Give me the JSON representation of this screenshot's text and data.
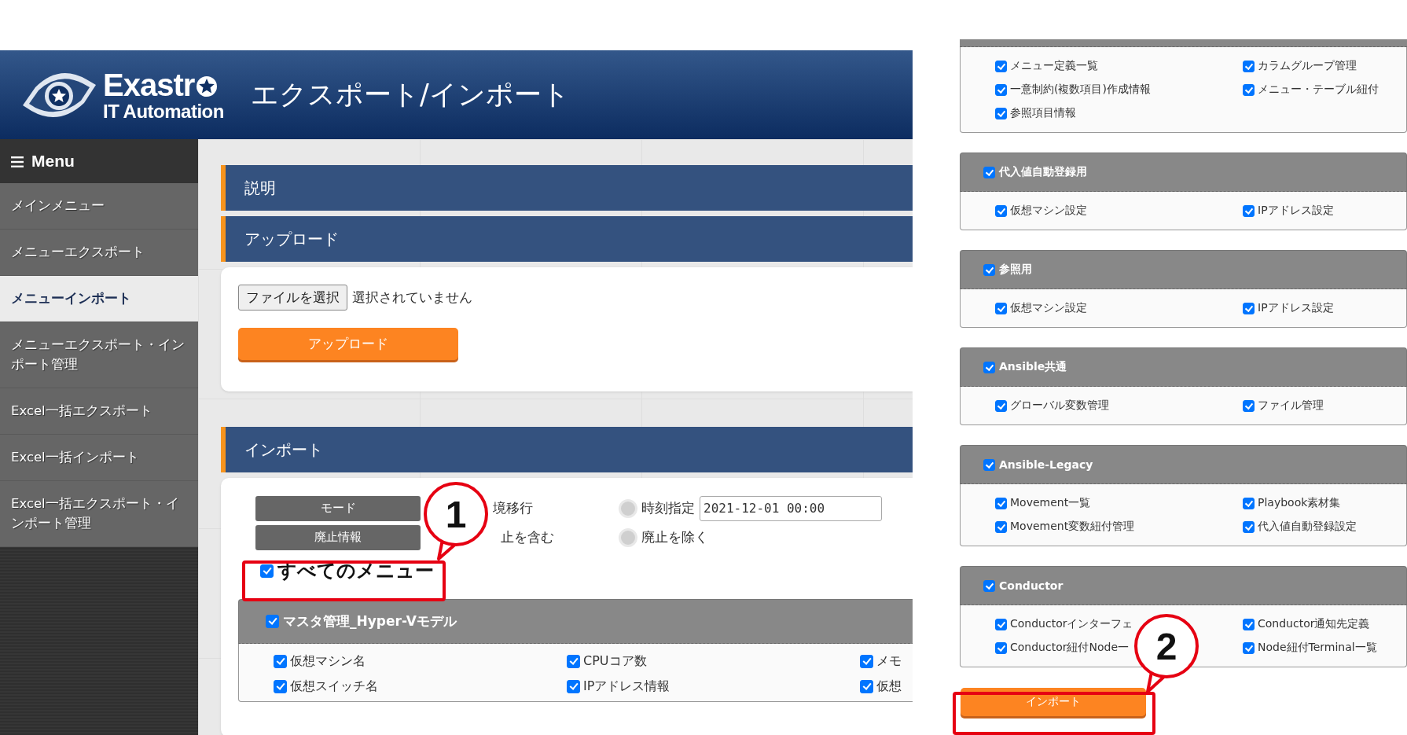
{
  "header": {
    "logo_text": "Exastr",
    "logo_subtext": "IT Automation",
    "title": "エクスポート/インポート"
  },
  "sidebar": {
    "title": "Menu",
    "items": [
      {
        "label": "メインメニュー",
        "selected": false
      },
      {
        "label": "メニューエクスポート",
        "selected": false
      },
      {
        "label": "メニューインポート",
        "selected": true
      },
      {
        "label": "メニューエクスポート・インポート管理",
        "selected": false
      },
      {
        "label": "Excel一括エクスポート",
        "selected": false
      },
      {
        "label": "Excel一括インポート",
        "selected": false
      },
      {
        "label": "Excel一括エクスポート・インポート管理",
        "selected": false
      }
    ]
  },
  "sections": [
    {
      "title": "説明"
    },
    {
      "title": "アップロード"
    }
  ],
  "upload": {
    "file_button": "ファイルを選択",
    "file_status": "選択されていません",
    "button": "アップロード"
  },
  "import": {
    "title": "インポート",
    "rows": [
      {
        "label": "モード",
        "options": [
          {
            "label": "境移行"
          },
          {
            "label": "時刻指定",
            "selected": false,
            "value": "2021-12-01 00:00"
          }
        ]
      },
      {
        "label": "廃止情報",
        "options": [
          {
            "label": "止を含む"
          },
          {
            "label": "廃止を除く",
            "selected": false
          }
        ]
      }
    ],
    "all_menus": {
      "label": "すべてのメニュー",
      "checked": true
    },
    "group": {
      "title": "マスタ管理_Hyper-Vモデル",
      "checked": true,
      "items": [
        {
          "label": "仮想マシン名",
          "checked": true
        },
        {
          "label": "CPUコア数",
          "checked": true
        },
        {
          "label": "メモ",
          "checked": true
        },
        {
          "label": "仮想スイッチ名",
          "checked": true
        },
        {
          "label": "IPアドレス情報",
          "checked": true
        },
        {
          "label": "仮想",
          "checked": true
        }
      ]
    }
  },
  "right_groups": [
    {
      "items": [
        {
          "label": "メニュー定義一覧",
          "checked": true
        },
        {
          "label": "カラムグループ管理",
          "checked": true
        },
        {
          "label": "一意制約(複数項目)作成情報",
          "checked": true
        },
        {
          "label": "メニュー・テーブル紐付",
          "checked": true
        },
        {
          "label": "参照項目情報",
          "checked": true
        }
      ]
    },
    {
      "title": "代入値自動登録用",
      "checked": true,
      "items": [
        {
          "label": "仮想マシン設定",
          "checked": true
        },
        {
          "label": "IPアドレス設定",
          "checked": true
        }
      ]
    },
    {
      "title": "参照用",
      "checked": true,
      "items": [
        {
          "label": "仮想マシン設定",
          "checked": true
        },
        {
          "label": "IPアドレス設定",
          "checked": true
        }
      ]
    },
    {
      "title": "Ansible共通",
      "checked": true,
      "items": [
        {
          "label": "グローバル変数管理",
          "checked": true
        },
        {
          "label": "ファイル管理",
          "checked": true
        }
      ]
    },
    {
      "title": "Ansible-Legacy",
      "checked": true,
      "items": [
        {
          "label": "Movement一覧",
          "checked": true
        },
        {
          "label": "Playbook素材集",
          "checked": true
        },
        {
          "label": "Movement変数紐付管理",
          "checked": true
        },
        {
          "label": "代入値自動登録設定",
          "checked": true
        }
      ]
    },
    {
      "title": "Conductor",
      "checked": true,
      "items": [
        {
          "label": "Conductorインターフェ",
          "checked": true
        },
        {
          "label": "Conductor通知先定義",
          "checked": true
        },
        {
          "label": "Conductor紐付Node一",
          "checked": true
        },
        {
          "label": "Node紐付Terminal一覧",
          "checked": true
        }
      ]
    }
  ],
  "import_button": "インポート",
  "callouts": [
    {
      "number": "1"
    },
    {
      "number": "2"
    }
  ]
}
